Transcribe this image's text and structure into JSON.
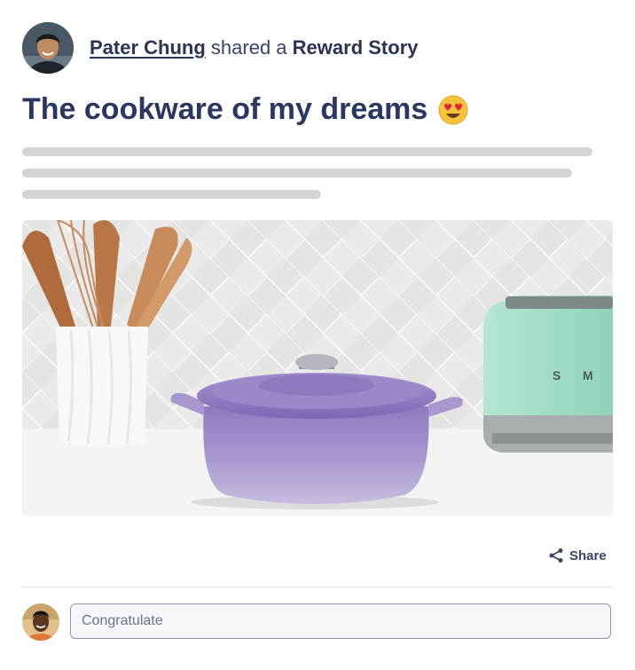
{
  "post": {
    "author": "Pater Chung",
    "action_text": "shared a",
    "story_type": "Reward Story",
    "title": "The cookware of my dreams",
    "title_emoji": "heart-eyes-emoji",
    "image_alt": "lavender dutch oven on kitchen counter"
  },
  "actions": {
    "share_label": "Share",
    "share_icon": "share-icon"
  },
  "comment": {
    "placeholder": "Congratulate"
  },
  "colors": {
    "title": "#2b3760",
    "skeleton": "#d3d4d8",
    "input_border": "#8d94ad",
    "pot": "#9c8bc7",
    "toaster": "#9fdcc5"
  }
}
